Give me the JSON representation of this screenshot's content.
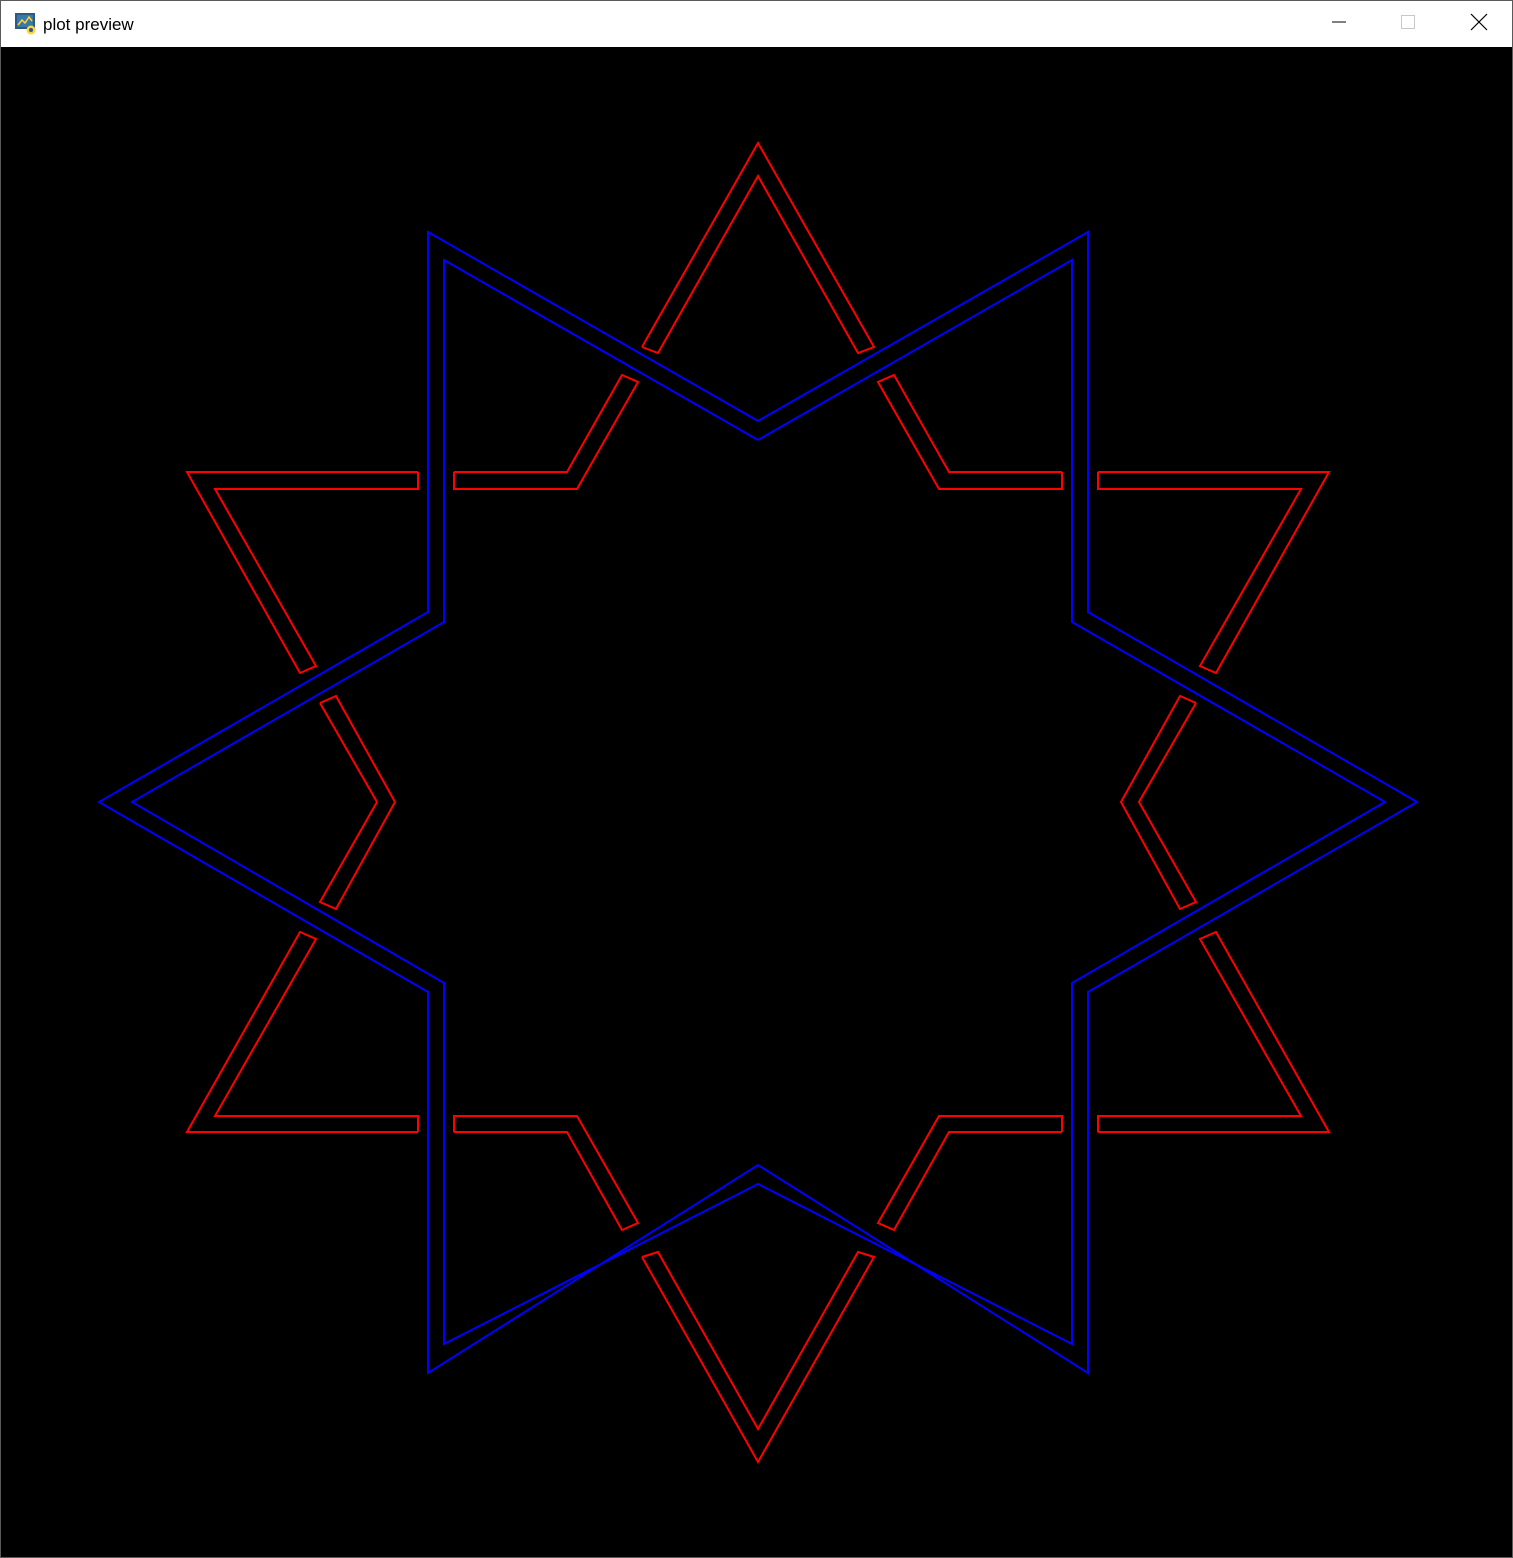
{
  "window": {
    "title": "plot preview",
    "icon": "python-plot-icon",
    "controls": {
      "minimize_icon": "minimize-icon",
      "maximize_icon": "maximize-icon",
      "close_icon": "close-icon"
    }
  },
  "plot": {
    "background": "#000000",
    "colors": {
      "outer_star": "#ff0000",
      "inner_star": "#0000ff"
    }
  }
}
